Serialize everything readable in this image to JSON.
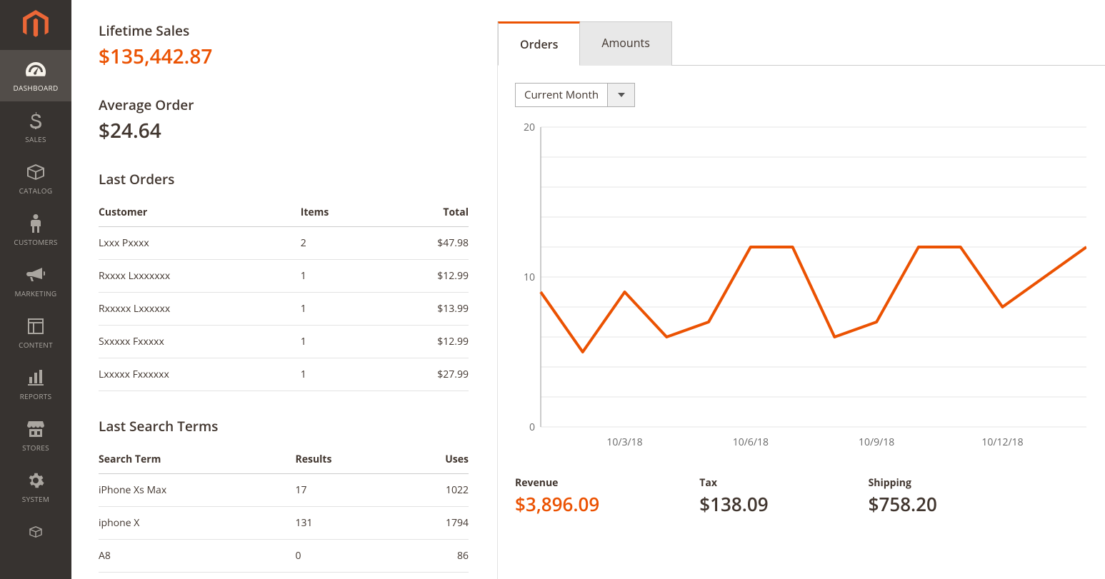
{
  "sidebar": {
    "items": [
      {
        "label": "DASHBOARD",
        "icon": "dashboard-icon"
      },
      {
        "label": "SALES",
        "icon": "dollar-icon"
      },
      {
        "label": "CATALOG",
        "icon": "box-icon"
      },
      {
        "label": "CUSTOMERS",
        "icon": "person-icon"
      },
      {
        "label": "MARKETING",
        "icon": "megaphone-icon"
      },
      {
        "label": "CONTENT",
        "icon": "layout-icon"
      },
      {
        "label": "REPORTS",
        "icon": "chart-icon"
      },
      {
        "label": "STORES",
        "icon": "stores-icon"
      },
      {
        "label": "SYSTEM",
        "icon": "gear-icon"
      }
    ]
  },
  "stats": {
    "lifetime_label": "Lifetime Sales",
    "lifetime_value": "$135,442.87",
    "avg_label": "Average Order",
    "avg_value": "$24.64"
  },
  "last_orders": {
    "title": "Last Orders",
    "headers": {
      "customer": "Customer",
      "items": "Items",
      "total": "Total"
    },
    "rows": [
      {
        "customer": "Lxxx Pxxxx",
        "items": "2",
        "total": "$47.98"
      },
      {
        "customer": "Rxxxx Lxxxxxxx",
        "items": "1",
        "total": "$12.99"
      },
      {
        "customer": "Rxxxxx Lxxxxxx",
        "items": "1",
        "total": "$13.99"
      },
      {
        "customer": "Sxxxxx Fxxxxx",
        "items": "1",
        "total": "$12.99"
      },
      {
        "customer": "Lxxxxx Fxxxxxx",
        "items": "1",
        "total": "$27.99"
      }
    ]
  },
  "last_search": {
    "title": "Last Search Terms",
    "headers": {
      "term": "Search Term",
      "results": "Results",
      "uses": "Uses"
    },
    "rows": [
      {
        "term": "iPhone Xs Max",
        "results": "17",
        "uses": "1022"
      },
      {
        "term": "iphone X",
        "results": "131",
        "uses": "1794"
      },
      {
        "term": "A8",
        "results": "0",
        "uses": "86"
      }
    ]
  },
  "tabs": {
    "orders": "Orders",
    "amounts": "Amounts"
  },
  "dropdown": {
    "selected": "Current Month"
  },
  "metrics": {
    "revenue_label": "Revenue",
    "revenue_value": "$3,896.09",
    "tax_label": "Tax",
    "tax_value": "$138.09",
    "shipping_label": "Shipping",
    "shipping_value": "$758.20"
  },
  "chart_data": {
    "type": "line",
    "ylim": [
      0,
      20
    ],
    "y_ticks": [
      0,
      10,
      20
    ],
    "x_labels": [
      "10/3/18",
      "10/6/18",
      "10/9/18",
      "10/12/18"
    ],
    "values": [
      9,
      5,
      9,
      6,
      7,
      12,
      12,
      6,
      7,
      12,
      12,
      8,
      10,
      12
    ]
  }
}
